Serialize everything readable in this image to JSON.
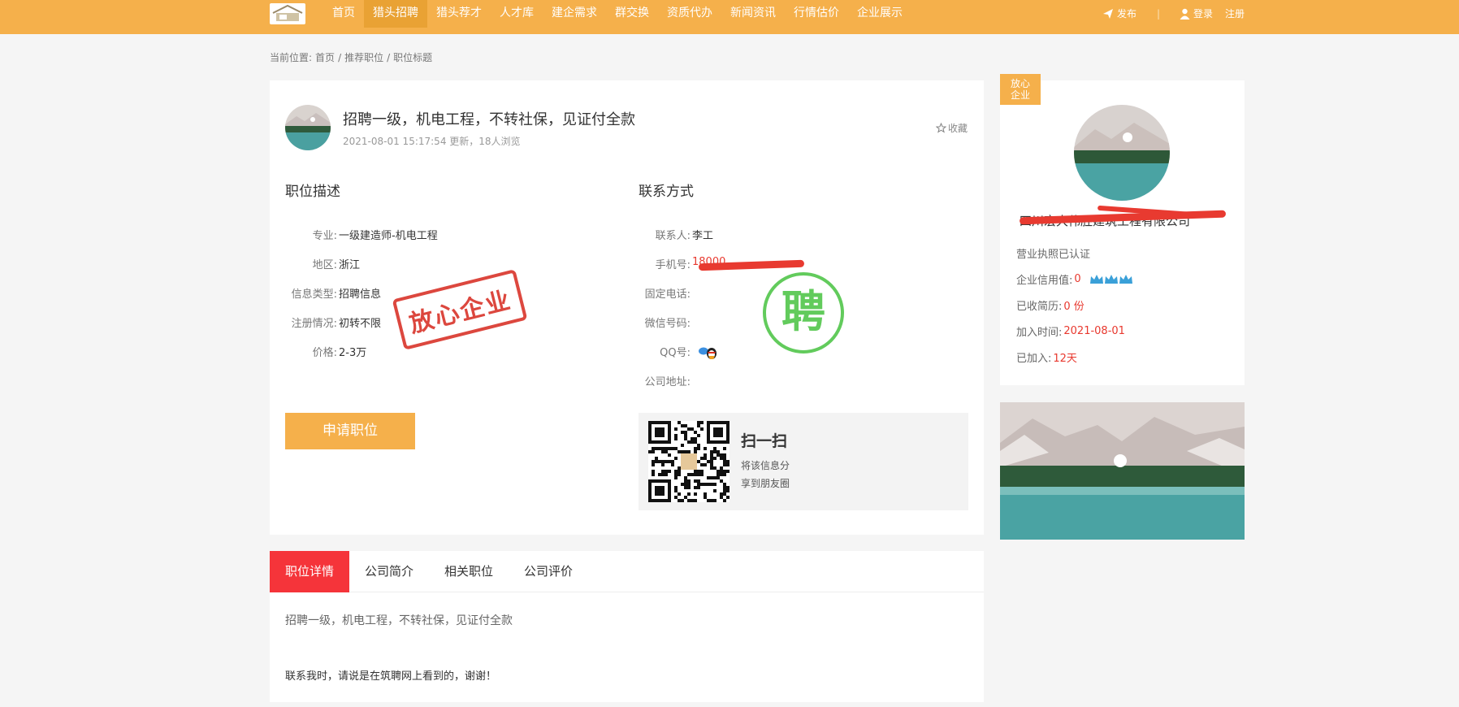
{
  "nav": {
    "items": [
      "首页",
      "猎头招聘",
      "猎头荐才",
      "人才库",
      "建企需求",
      "群交换",
      "资质代办",
      "新闻资讯",
      "行情估价",
      "企业展示"
    ],
    "active_index": 1
  },
  "user": {
    "publish": "发布",
    "login": "登录",
    "register": "注册"
  },
  "breadcrumb": {
    "prefix": "当前位置:",
    "home": "首页",
    "section": "推荐职位",
    "current": "职位标题",
    "sep": "/"
  },
  "job": {
    "title": "招聘一级，机电工程，不转社保，见证付全款",
    "meta": "2021-08-01 15:17:54 更新，18人浏览",
    "favorite": "收藏"
  },
  "description": {
    "title": "职位描述",
    "fields": [
      {
        "label": "专业:",
        "value": "一级建造师-机电工程"
      },
      {
        "label": "地区:",
        "value": "浙江"
      },
      {
        "label": "信息类型:",
        "value": "招聘信息"
      },
      {
        "label": "注册情况:",
        "value": "初转不限"
      },
      {
        "label": "价格:",
        "value": "2-3万"
      }
    ]
  },
  "contact": {
    "title": "联系方式",
    "fields": [
      {
        "label": "联系人:",
        "value": "李工"
      },
      {
        "label": "手机号:",
        "value": "18000"
      },
      {
        "label": "固定电话:",
        "value": ""
      },
      {
        "label": "微信号码:",
        "value": ""
      },
      {
        "label": "QQ号:",
        "value": ""
      },
      {
        "label": "公司地址:",
        "value": ""
      }
    ]
  },
  "apply_label": "申请职位",
  "scan": {
    "title": "扫一扫",
    "line1": "将该信息分",
    "line2": "享到朋友圈"
  },
  "stamps": {
    "trusted": "放心企业",
    "hire": "聘"
  },
  "tabs": {
    "items": [
      "职位详情",
      "公司简介",
      "相关职位",
      "公司评价"
    ],
    "active_index": 0
  },
  "detail": {
    "text": "招聘一级，机电工程，不转社保，见证付全款",
    "note": "联系我时，请说是在筑聘网上看到的，谢谢！"
  },
  "company": {
    "badge_line1": "放心",
    "badge_line2": "企业",
    "name": "四川宏大伟胜建筑工程有限公司",
    "license": "营业执照已认证",
    "credit_label": "企业信用值:",
    "credit_value": "0",
    "resumes_label": "已收简历:",
    "resumes_value": "0 份",
    "joined_label": "加入时间:",
    "joined_value": "2021-08-01",
    "days_label": "已加入:",
    "days_value": "12天"
  },
  "colors": {
    "brand": "#f5b04b",
    "accent_red": "#f5343a",
    "stamp_green": "#62cb5c"
  }
}
